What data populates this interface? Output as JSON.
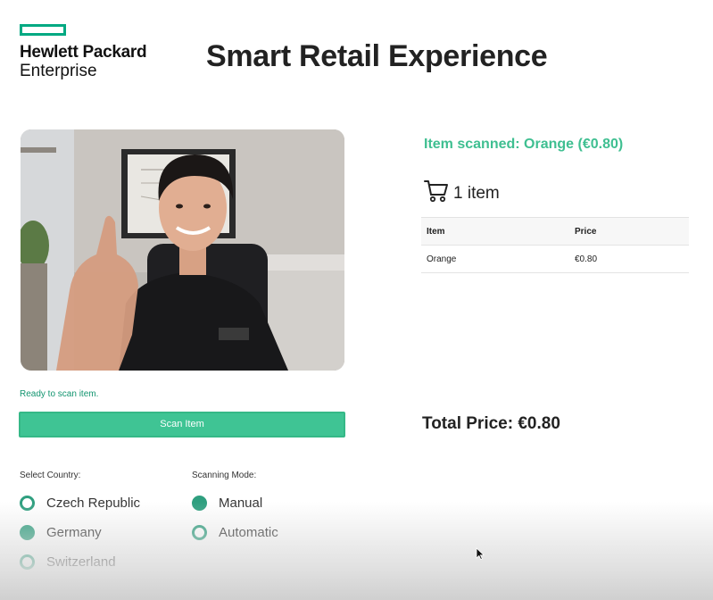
{
  "logo": {
    "line1": "Hewlett Packard",
    "line2": "Enterprise",
    "accent": "#01a982"
  },
  "title": "Smart Retail Experience",
  "camera": {
    "status": "Ready to scan item."
  },
  "scan_button": {
    "label": "Scan Item",
    "color": "#3fc494"
  },
  "country": {
    "label": "Select Country:",
    "options": [
      {
        "label": "Czech Republic",
        "selected": false
      },
      {
        "label": "Germany",
        "selected": true
      },
      {
        "label": "Switzerland",
        "selected": false
      }
    ]
  },
  "mode": {
    "label": "Scanning Mode:",
    "options": [
      {
        "label": "Manual",
        "selected": true
      },
      {
        "label": "Automatic",
        "selected": false
      }
    ]
  },
  "scan_result": {
    "message": "Item scanned: Orange (€0.80)",
    "color": "#3fbf91"
  },
  "cart": {
    "icon": "cart-icon",
    "count_text": "1 item"
  },
  "table": {
    "headers": [
      "Item",
      "Price"
    ],
    "rows": [
      [
        "Orange",
        "€0.80"
      ]
    ]
  },
  "total": {
    "text": "Total Price: €0.80"
  }
}
